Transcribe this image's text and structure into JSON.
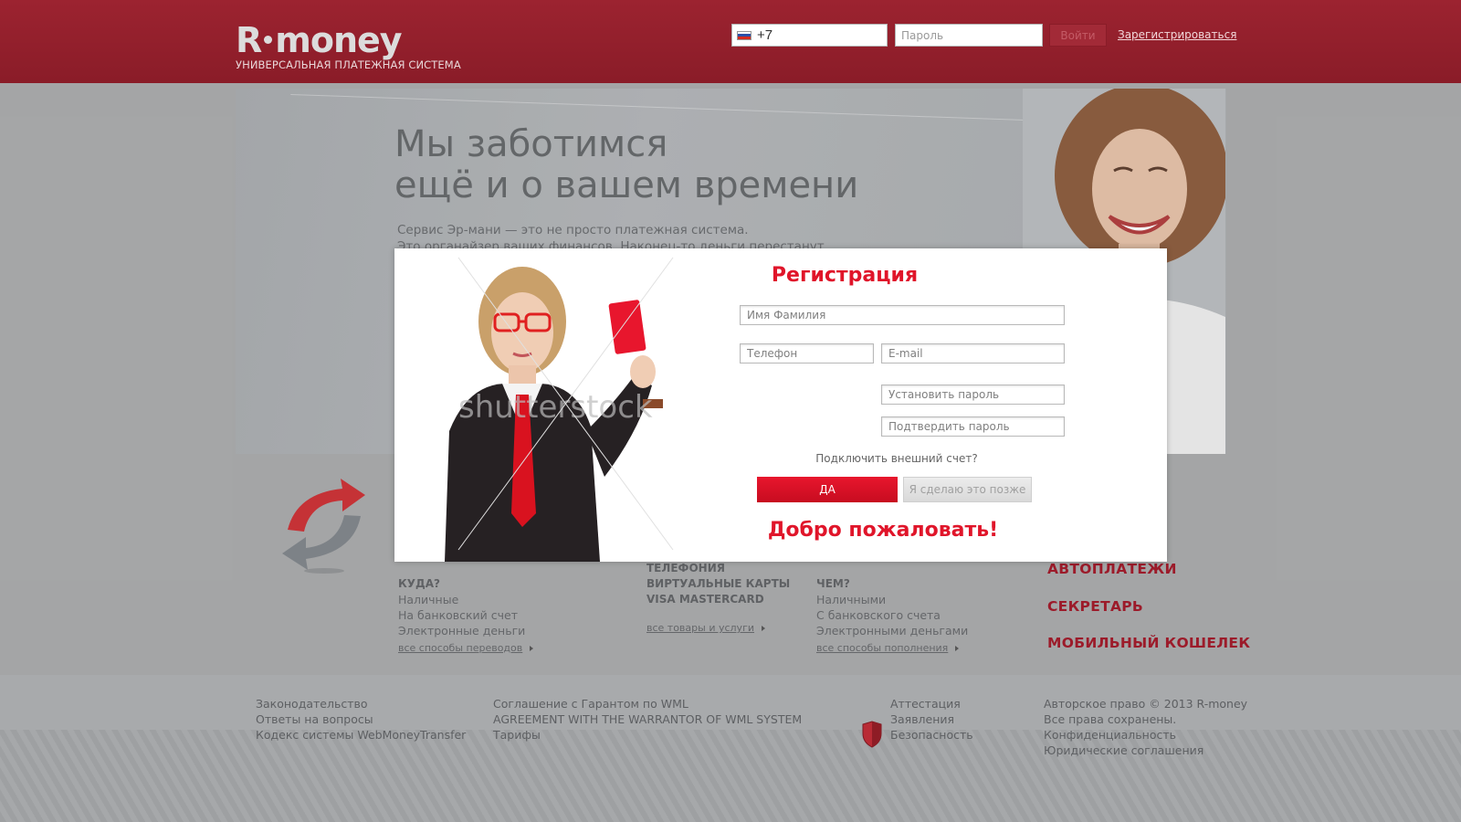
{
  "header": {
    "logo_left": "R",
    "logo_right": "money",
    "tagline": "УНИВЕРСАЛЬНАЯ ПЛАТЕЖНАЯ СИСТЕМА",
    "phone_value": "+7",
    "password_placeholder": "Пароль",
    "login_label": "Войти",
    "register_label": "Зарегистрироваться",
    "flag_colors": [
      "#ffffff",
      "#2b4fa8",
      "#d52b1e"
    ]
  },
  "hero": {
    "title_line1": "Мы заботимся",
    "title_line2": "ещё и о вашем времени",
    "text_line1": "Сервис Эр-мани — это не просто платежная система.",
    "text_line2": "Это органайзер ваших финансов. Наконец-то деньги перестанут"
  },
  "sections": {
    "partial_top": "ТЕЛЕФОНИЯ",
    "where": {
      "title": "КУДА?",
      "items": [
        "Наличные",
        "На банковский счет",
        "Электронные деньги"
      ],
      "link": "все способы переводов"
    },
    "goods": {
      "items": [
        "ВИРТУАЛЬНЫЕ КАРТЫ",
        "VISA MASTERCARD"
      ],
      "link": "все товары и услуги"
    },
    "how": {
      "title": "ЧЕМ?",
      "items": [
        "Наличными",
        "С банковского счета",
        "Электронными деньгами"
      ],
      "link": "все способы пополнения"
    },
    "services": [
      "АВТОПЛАТЕЖИ",
      "СЕКРЕТАРЬ",
      "МОБИЛЬНЫЙ КОШЕЛЕК"
    ]
  },
  "footer": {
    "col1": [
      "Законодательство",
      "Ответы на вопросы",
      "Кодекс системы WebMoneyTransfer"
    ],
    "col2": [
      "Соглашение с Гарантом по WML",
      "AGREEMENT WITH THE WARRANTOR OF WML SYSTEM",
      "Тарифы"
    ],
    "col3": [
      "Аттестация",
      "Заявления",
      "Безопасность"
    ],
    "col4": [
      "Авторское право © 2013 R-money",
      "Все права сохранены.",
      "Конфиденциальность",
      "Юридические соглашения"
    ]
  },
  "modal": {
    "title": "Регистрация",
    "name_placeholder": "Имя Фамилия",
    "phone_placeholder": "Телефон",
    "email_placeholder": "E-mail",
    "set_password_placeholder": "Установить пароль",
    "confirm_password_placeholder": "Подтвердить пароль",
    "connect_question": "Подключить внешний счет?",
    "yes_label": "ДА",
    "later_label": "Я сделаю это позже",
    "welcome": "Добро пожаловать!",
    "watermark": "shutterstock"
  },
  "colors": {
    "brand_red": "#e0152a",
    "header_red": "#8a1c28",
    "service_red": "#9c1b2a"
  }
}
